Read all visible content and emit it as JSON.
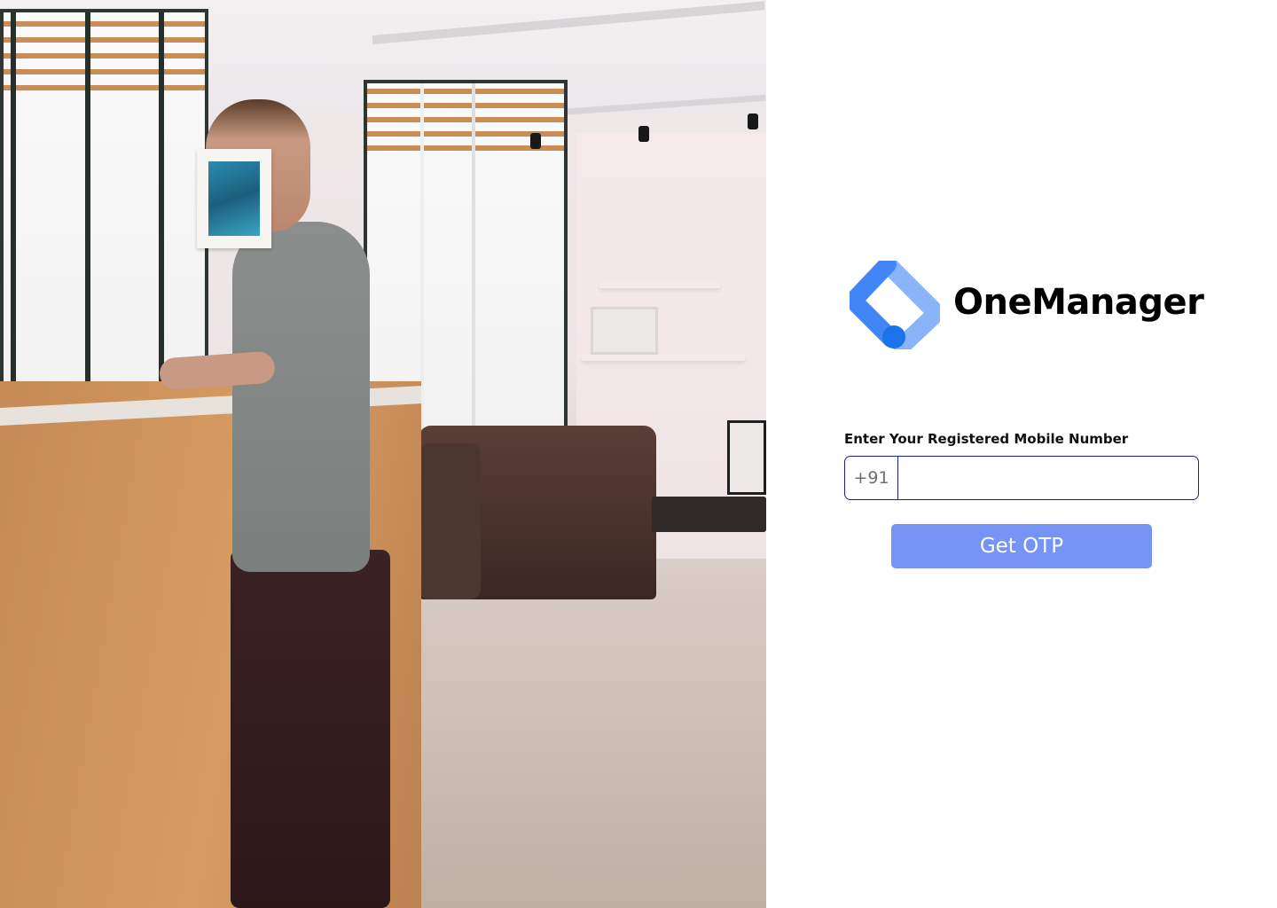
{
  "brand": {
    "name": "OneManager",
    "logo_icon": "diamond-tag-logo-icon",
    "logo_colors": {
      "primary": "#4285f4",
      "secondary": "#8ab4f8",
      "dot": "#1a73e8"
    }
  },
  "hero_image": {
    "icon": "office-photo"
  },
  "login": {
    "field_label": "Enter Your Registered Mobile Number",
    "country_code": "+91",
    "phone_value": "",
    "phone_placeholder": "",
    "submit_label": "Get OTP"
  },
  "colors": {
    "input_border": "#1b1f8f",
    "button_bg": "#7594f5",
    "button_text": "#ffffff"
  }
}
